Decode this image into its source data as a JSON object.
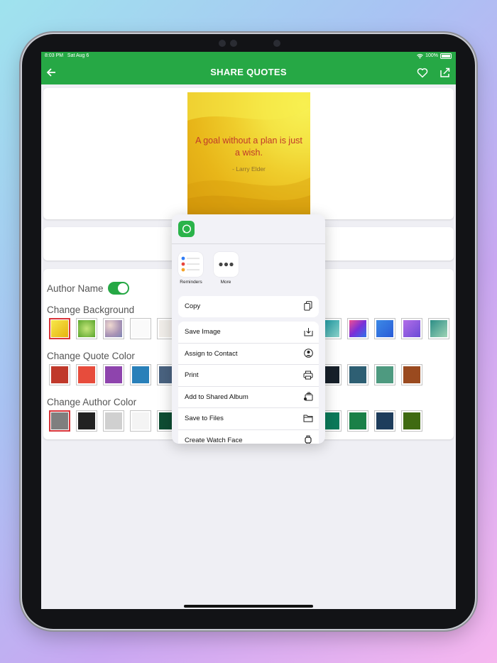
{
  "status": {
    "time": "8:03 PM",
    "date": "Sat Aug 6",
    "battery": "100%"
  },
  "header": {
    "title": "SHARE QUOTES"
  },
  "quote": {
    "text": "A goal without a plan is just a wish.",
    "author": "- Larry Elder"
  },
  "settings": {
    "author_name_label": "Author Name",
    "author_name_enabled": true,
    "background_label": "Change Background",
    "quote_color_label": "Change Quote Color",
    "author_color_label": "Change Author Color"
  },
  "colors": {
    "accent": "#26a845",
    "quote_colors_left": [
      "#c0392b",
      "#e74c3c",
      "#8e44ad",
      "#2980b9",
      "#4a6381"
    ],
    "quote_colors_right": [
      "#17202a",
      "#2e5f73",
      "#4e9a80",
      "#9a4a1f"
    ],
    "author_colors_left": [
      "#7f7f7f",
      "#222222",
      "#d0d0d0",
      "#f4f4f4",
      "#0e4d33"
    ],
    "author_colors_right": [
      "#0a7a5a",
      "#1a8048",
      "#1e3d5c",
      "#3f6a12"
    ]
  },
  "share_sheet": {
    "app_icon": "message-app-icon",
    "actions": [
      {
        "label": "Reminders",
        "icon": "reminders-icon"
      },
      {
        "label": "More",
        "icon": "more-icon"
      }
    ],
    "copy": {
      "label": "Copy",
      "icon": "copy-icon"
    },
    "rows": [
      {
        "label": "Save Image",
        "icon": "save-image-icon"
      },
      {
        "label": "Assign to Contact",
        "icon": "contact-icon"
      },
      {
        "label": "Print",
        "icon": "printer-icon"
      },
      {
        "label": "Add to Shared Album",
        "icon": "shared-album-icon"
      },
      {
        "label": "Save to Files",
        "icon": "folder-icon"
      },
      {
        "label": "Create Watch Face",
        "icon": "watch-icon"
      }
    ]
  }
}
